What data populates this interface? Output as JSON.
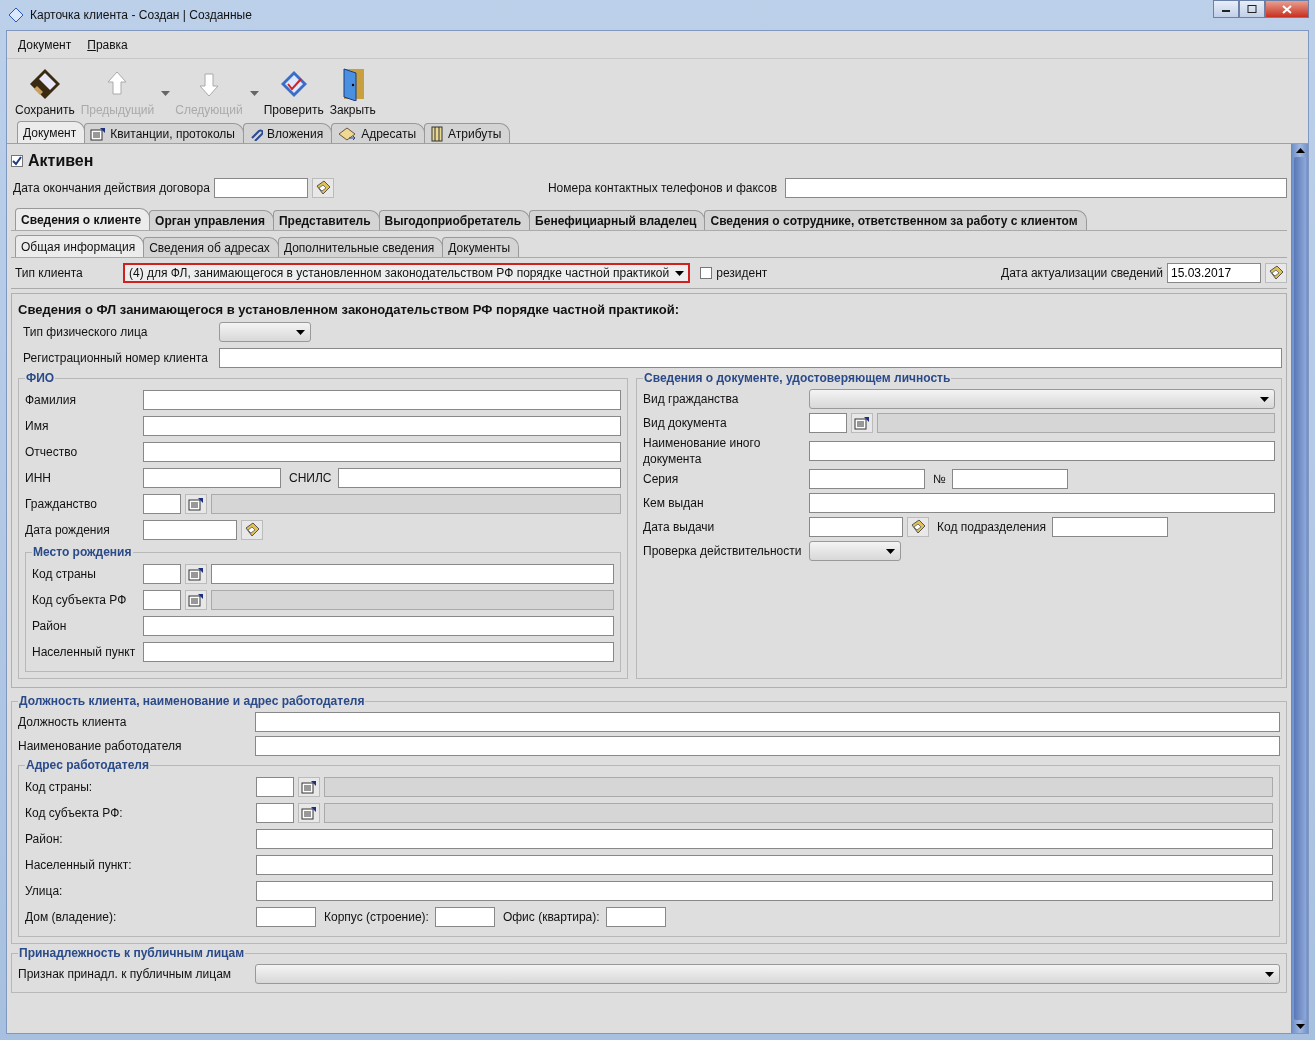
{
  "window": {
    "title": "Карточка клиента - Создан | Созданные"
  },
  "menu": [
    {
      "label": "Документ"
    },
    {
      "label": "Правка"
    }
  ],
  "toolbar": [
    {
      "kind": "save",
      "label": "Сохранить",
      "disabled": false,
      "dropdown": false
    },
    {
      "kind": "previous",
      "label": "Предыдущий",
      "disabled": true,
      "dropdown": true
    },
    {
      "kind": "next",
      "label": "Следующий",
      "disabled": true,
      "dropdown": true
    },
    {
      "kind": "check",
      "label": "Проверить",
      "disabled": false,
      "dropdown": false
    },
    {
      "kind": "close",
      "label": "Закрыть",
      "disabled": false,
      "dropdown": false
    }
  ],
  "doc_tabs": [
    {
      "kind": "plain",
      "label": "Документ",
      "selected": true
    },
    {
      "kind": "receipts",
      "label": "Квитанции, протоколы",
      "selected": false
    },
    {
      "kind": "attachments",
      "label": "Вложения",
      "selected": false
    },
    {
      "kind": "addressees",
      "label": "Адресаты",
      "selected": false
    },
    {
      "kind": "attributes",
      "label": "Атрибуты",
      "selected": false
    }
  ],
  "active": {
    "label": "Активен",
    "checked": true
  },
  "contract_end": {
    "label": "Дата окончания действия договора"
  },
  "phones": {
    "label": "Номера контактных телефонов и факсов"
  },
  "section_tabs": [
    {
      "label": "Сведения о клиенте",
      "selected": true
    },
    {
      "label": "Орган управления",
      "selected": false
    },
    {
      "label": "Представитель",
      "selected": false
    },
    {
      "label": "Выгодоприобретатель",
      "selected": false
    },
    {
      "label": "Бенефициарный владелец",
      "selected": false
    },
    {
      "label": "Сведения о сотруднике, ответственном за работу с клиентом",
      "selected": false
    }
  ],
  "sub_tabs": [
    {
      "label": "Общая информация",
      "selected": true
    },
    {
      "label": "Сведения об адресах",
      "selected": false
    },
    {
      "label": "Дополнительные сведения",
      "selected": false
    },
    {
      "label": "Документы",
      "selected": false
    }
  ],
  "client_type": {
    "label": "Тип клиента",
    "value": "(4) для ФЛ, занимающегося в установленном законодательством РФ порядке частной практикой",
    "highlighted": true
  },
  "resident": {
    "label": "резидент",
    "checked": false
  },
  "update_date": {
    "label": "Дата актуализации сведений",
    "value": "15.03.2017"
  },
  "heading": "Сведения о ФЛ занимающегося в установленном законодательством РФ порядке частной практикой:",
  "top_rows": [
    {
      "kind": "select",
      "label": "Тип физического лица",
      "wide": false
    },
    {
      "kind": "text",
      "label": "Регистрационный номер клиента"
    }
  ],
  "fio": {
    "title": "ФИО",
    "rows": [
      {
        "kind": "text",
        "label": "Фамилия"
      },
      {
        "kind": "text",
        "label": "Имя"
      },
      {
        "kind": "text",
        "label": "Отчество"
      },
      {
        "kind": "pair",
        "label": "ИНН",
        "label2": "СНИЛС"
      },
      {
        "kind": "lookup",
        "label": "Гражданство",
        "name_editable": false
      },
      {
        "kind": "date",
        "label": "Дата рождения"
      }
    ]
  },
  "birthplace": {
    "title": "Место рождения",
    "rows": [
      {
        "kind": "lookup",
        "label": "Код страны",
        "name_editable": true
      },
      {
        "kind": "lookup",
        "label": "Код субъекта РФ",
        "name_editable": false
      },
      {
        "kind": "text",
        "label": "Район"
      },
      {
        "kind": "text",
        "label": "Населенный пункт"
      }
    ]
  },
  "id_document": {
    "title": "Сведения о документе, удостоверяющем личность",
    "rows": [
      {
        "kind": "select",
        "label": "Вид гражданства",
        "wide": true
      },
      {
        "kind": "lookup",
        "label": "Вид документа",
        "name_editable": false
      },
      {
        "kind": "text",
        "label": "Наименование иного документа"
      },
      {
        "kind": "series",
        "label": "Серия",
        "label2": "№"
      },
      {
        "kind": "text",
        "label": "Кем выдан"
      },
      {
        "kind": "date",
        "label": "Дата выдачи",
        "label2": "Код подразделения"
      },
      {
        "kind": "select",
        "label": "Проверка действительности",
        "wide": false
      }
    ]
  },
  "employer": {
    "title": "Должность клиента, наименование и адрес работодателя",
    "rows": [
      {
        "kind": "text",
        "label": "Должность клиента"
      },
      {
        "kind": "text",
        "label": "Наименование работодателя"
      }
    ],
    "address": {
      "title": "Адрес работодателя",
      "rows": [
        {
          "kind": "lookup",
          "label": "Код страны:",
          "name_editable": false
        },
        {
          "kind": "lookup",
          "label": "Код субъекта РФ:",
          "name_editable": false
        },
        {
          "kind": "text",
          "label": "Район:"
        },
        {
          "kind": "text",
          "label": "Населенный пункт:"
        },
        {
          "kind": "text",
          "label": "Улица:"
        },
        {
          "kind": "triple",
          "label": "Дом (владение):",
          "label2": "Корпус (строение):",
          "label3": "Офис (квартира):"
        }
      ]
    }
  },
  "public": {
    "title": "Принадлежность к публичным лицам",
    "rows": [
      {
        "kind": "select",
        "label": "Признак принадл. к публичным лицам",
        "wide": true
      }
    ]
  }
}
